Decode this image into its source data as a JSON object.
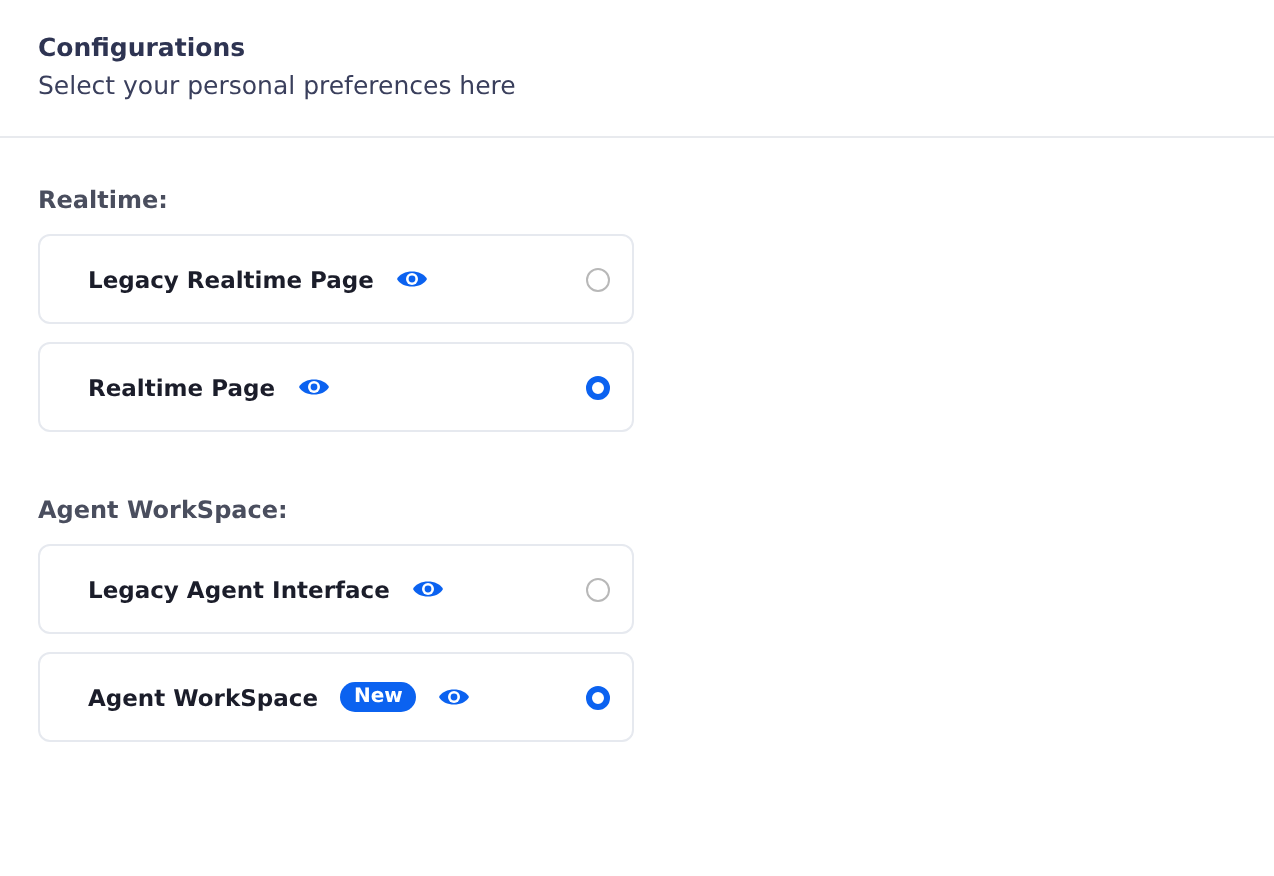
{
  "header": {
    "title": "Configurations",
    "subtitle": "Select your personal preferences here"
  },
  "sections": [
    {
      "label": "Realtime:",
      "options": [
        {
          "label": "Legacy Realtime Page",
          "selected": false
        },
        {
          "label": "Realtime Page",
          "selected": true
        }
      ]
    },
    {
      "label": "Agent WorkSpace:",
      "options": [
        {
          "label": "Legacy Agent Interface",
          "selected": false
        },
        {
          "label": "Agent WorkSpace",
          "badge": "New",
          "selected": true
        }
      ]
    }
  ]
}
